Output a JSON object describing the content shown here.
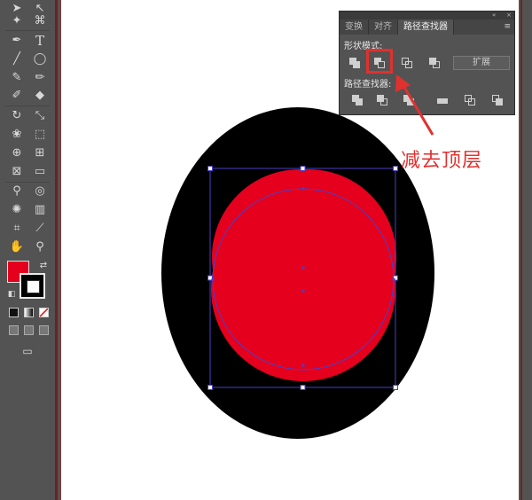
{
  "toolbar": {
    "tools": [
      "selection-tool",
      "direct-selection-tool",
      "magic-wand-tool",
      "lasso-tool",
      "pen-tool",
      "type-tool",
      "line-tool",
      "ellipse-tool",
      "paintbrush-tool",
      "pencil-tool",
      "blob-brush-tool",
      "eraser-tool",
      "rotate-tool",
      "scale-tool",
      "warp-tool",
      "free-transform-tool",
      "shape-builder-tool",
      "perspective-grid-tool",
      "mesh-tool",
      "gradient-tool",
      "eyedropper-tool",
      "blend-tool",
      "symbol-sprayer-tool",
      "column-graph-tool",
      "artboard-tool",
      "slice-tool",
      "hand-tool",
      "zoom-tool"
    ],
    "fill_color": "#e5001d",
    "stroke_color": "#000000"
  },
  "panel": {
    "tabs": [
      "变换",
      "对齐",
      "路径查找器"
    ],
    "active_tab": "路径查找器",
    "shape_modes_label": "形状模式:",
    "pathfinders_label": "路径查找器:",
    "expand_label": "扩展",
    "collapse_icon": "«",
    "close_icon": "×",
    "menu_icon": "≡"
  },
  "annotation": {
    "text": "减去顶层",
    "color": "#e0312f"
  },
  "artwork": {
    "ellipse_color": "#000000",
    "circle_color": "#e5001d",
    "selection_color": "#4a3fc8"
  }
}
